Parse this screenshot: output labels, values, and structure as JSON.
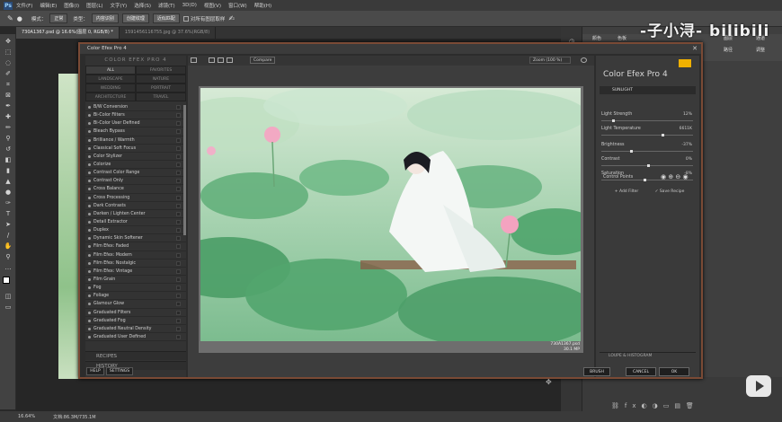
{
  "menubar": {
    "items": [
      "文件(F)",
      "编辑(E)",
      "图像(I)",
      "图层(L)",
      "文字(Y)",
      "选择(S)",
      "滤镜(T)",
      "3D(D)",
      "视图(V)",
      "窗口(W)",
      "帮助(H)"
    ]
  },
  "options": {
    "mode_label": "模式：",
    "mode_value": "正常",
    "type_label": "类型：",
    "type_value": "内容识别",
    "btn_create": "创建纹理",
    "btn_proximity": "近似匹配",
    "sample_all": "对所有图层取样"
  },
  "tabs": [
    "730A1367.psd @ 16.6%(图层 0, RGB/8) *",
    "1591456116755.jpg @ 37.6%(RGB/8)"
  ],
  "status": {
    "zoom": "16.64%",
    "doc": "文档:86.3M/735.1M"
  },
  "watermark": "-子小浔- bilibili",
  "rightpanel": {
    "labels": [
      "颜色",
      "色板",
      "图层",
      "通道",
      "路径",
      "调整"
    ]
  },
  "dialog": {
    "title": "Color Efex Pro 4",
    "categories_title": "COLOR EFEX PRO 4",
    "categories": [
      "ALL",
      "FAVORITES",
      "LANDSCAPE",
      "NATURE",
      "WEDDING",
      "PORTRAIT",
      "ARCHITECTURE",
      "TRAVEL"
    ],
    "filters": [
      "B/W Conversion",
      "Bi-Color Filters",
      "Bi-Color User Defined",
      "Bleach Bypass",
      "Brilliance / Warmth",
      "Classical Soft Focus",
      "Color Stylizer",
      "Colorize",
      "Contrast Color Range",
      "Contrast Only",
      "Cross Balance",
      "Cross Processing",
      "Dark Contrasts",
      "Darken / Lighten Center",
      "Detail Extractor",
      "Duplex",
      "Dynamic Skin Softener",
      "Film Efex: Faded",
      "Film Efex: Modern",
      "Film Efex: Nostalgic",
      "Film Efex: Vintage",
      "Film Grain",
      "Fog",
      "Foliage",
      "Glamour Glow",
      "Graduated Filters",
      "Graduated Fog",
      "Graduated Neutral Density",
      "Graduated User Defined"
    ],
    "sections": [
      "RECIPES",
      "HISTORY"
    ],
    "help": "HELP",
    "settings": "SETTINGS",
    "compare": "Compare",
    "zoom": "Zoom (100 %)",
    "filename": "730A1367.psd",
    "filesize": "30.1 MP",
    "brand": "Color Efex Pro",
    "brand_version": "4",
    "active_filter": "SUNLIGHT",
    "sliders": [
      {
        "label": "Light Strength",
        "value": "12%",
        "pos": 0.12
      },
      {
        "label": "Light Temperature",
        "value": "6611K",
        "pos": 0.66
      },
      {
        "label": "Brightness",
        "value": "-37%",
        "pos": 0.31
      },
      {
        "label": "Contrast",
        "value": "0%",
        "pos": 0.5
      },
      {
        "label": "Saturation",
        "value": "-8%",
        "pos": 0.46
      }
    ],
    "control_points": "Control Points",
    "add_filter": "Add Filter",
    "save_recipe": "Save Recipe",
    "loupe": "LOUPE & HISTOGRAM",
    "brush": "BRUSH",
    "cancel": "CANCEL",
    "ok": "OK"
  }
}
